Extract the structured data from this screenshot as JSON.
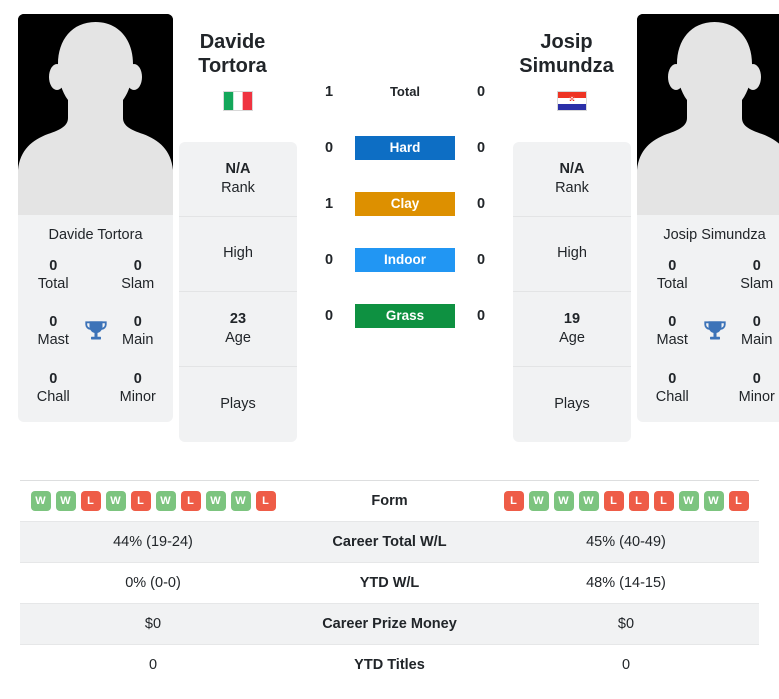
{
  "players": {
    "left": {
      "first_name": "Davide",
      "last_name": "Tortora",
      "full_name": "Davide Tortora",
      "country": "Italy",
      "flag_icon": "flag-italy-icon",
      "avatar_icon": "player-avatar-placeholder-icon",
      "rank_value": "N/A",
      "rank_label": "Rank",
      "high_label": "High",
      "high_value": "",
      "age_value": "23",
      "age_label": "Age",
      "plays_label": "Plays",
      "plays_value": "",
      "titles": {
        "total_value": "0",
        "total_label": "Total",
        "slam_value": "0",
        "slam_label": "Slam",
        "mast_value": "0",
        "mast_label": "Mast",
        "main_value": "0",
        "main_label": "Main",
        "chall_value": "0",
        "chall_label": "Chall",
        "minor_value": "0",
        "minor_label": "Minor"
      },
      "form": [
        "W",
        "W",
        "L",
        "W",
        "L",
        "W",
        "L",
        "W",
        "W",
        "L"
      ],
      "career_total_wl": "44% (19-24)",
      "ytd_wl": "0% (0-0)",
      "career_prize_money": "$0",
      "ytd_titles": "0"
    },
    "right": {
      "first_name": "Josip",
      "last_name": "Simundza",
      "full_name": "Josip Simundza",
      "country": "Croatia",
      "flag_icon": "flag-croatia-icon",
      "avatar_icon": "player-avatar-placeholder-icon",
      "rank_value": "N/A",
      "rank_label": "Rank",
      "high_label": "High",
      "high_value": "",
      "age_value": "19",
      "age_label": "Age",
      "plays_label": "Plays",
      "plays_value": "",
      "titles": {
        "total_value": "0",
        "total_label": "Total",
        "slam_value": "0",
        "slam_label": "Slam",
        "mast_value": "0",
        "mast_label": "Mast",
        "main_value": "0",
        "main_label": "Main",
        "chall_value": "0",
        "chall_label": "Chall",
        "minor_value": "0",
        "minor_label": "Minor"
      },
      "form": [
        "L",
        "W",
        "W",
        "W",
        "L",
        "L",
        "L",
        "W",
        "W",
        "L"
      ],
      "career_total_wl": "45% (40-49)",
      "ytd_wl": "48% (14-15)",
      "career_prize_money": "$0",
      "ytd_titles": "0"
    }
  },
  "head_to_head": [
    {
      "label": "Total",
      "left": "1",
      "right": "0",
      "style": "plain",
      "color": ""
    },
    {
      "label": "Hard",
      "left": "0",
      "right": "0",
      "style": "badge",
      "color": "#0d6ec4"
    },
    {
      "label": "Clay",
      "left": "1",
      "right": "0",
      "style": "badge",
      "color": "#dd9000"
    },
    {
      "label": "Indoor",
      "left": "0",
      "right": "0",
      "style": "badge",
      "color": "#2196f3"
    },
    {
      "label": "Grass",
      "left": "0",
      "right": "0",
      "style": "badge",
      "color": "#0e9141"
    }
  ],
  "stats_rows": [
    {
      "label": "Form",
      "type": "form",
      "shaded": false
    },
    {
      "label": "Career Total W/L",
      "type": "text",
      "shaded": true,
      "left": "44% (19-24)",
      "right": "45% (40-49)"
    },
    {
      "label": "YTD W/L",
      "type": "text",
      "shaded": false,
      "left": "0% (0-0)",
      "right": "48% (14-15)"
    },
    {
      "label": "Career Prize Money",
      "type": "text",
      "shaded": true,
      "left": "$0",
      "right": "$0"
    },
    {
      "label": "YTD Titles",
      "type": "text",
      "shaded": false,
      "left": "0",
      "right": "0"
    }
  ],
  "colors": {
    "card_bg": "#f1f2f3",
    "trophy": "#3c73b8",
    "form_win": "#7cc47f",
    "form_loss": "#ee5c47",
    "text": "#212529"
  },
  "icons": {
    "trophy": "trophy-icon"
  }
}
